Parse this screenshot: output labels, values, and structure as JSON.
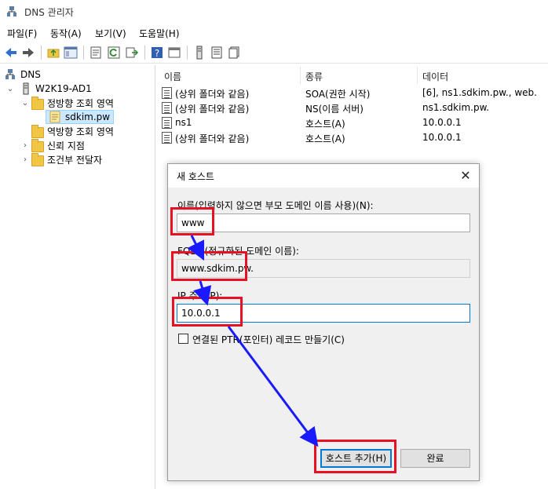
{
  "window": {
    "title": "DNS 관리자"
  },
  "menu": [
    "파일(F)",
    "동작(A)",
    "보기(V)",
    "도움말(H)"
  ],
  "toolbar": {
    "icons": [
      "back-icon",
      "forward-icon",
      "up-folder-icon",
      "show-tree-icon",
      "properties-icon",
      "refresh-icon",
      "export-icon",
      "help-icon",
      "console-icon",
      "server-icon",
      "record-icon",
      "copy-icon"
    ]
  },
  "tree": {
    "root": "DNS",
    "server": "W2K19-AD1",
    "forward_zone": "정방향 조회 영역",
    "zone": "sdkim.pw",
    "reverse_zone": "역방향 조회 영역",
    "trust_points": "신뢰 지점",
    "conditional_forwarders": "조건부 전달자"
  },
  "list": {
    "headers": [
      "이름",
      "종류",
      "데이터"
    ],
    "rows": [
      {
        "name": "(상위 폴더와 같음)",
        "type": "SOA(권한 시작)",
        "data": "[6], ns1.sdkim.pw., web."
      },
      {
        "name": "(상위 폴더와 같음)",
        "type": "NS(이름 서버)",
        "data": "ns1.sdkim.pw."
      },
      {
        "name": "ns1",
        "type": "호스트(A)",
        "data": "10.0.0.1"
      },
      {
        "name": "(상위 폴더와 같음)",
        "type": "호스트(A)",
        "data": "10.0.0.1"
      }
    ]
  },
  "dialog": {
    "title": "새 호스트",
    "close": "✕",
    "name_label": "이름(입력하지 않으면 부모 도메인 이름 사용)(N):",
    "name_value": "www",
    "fqdn_label": "FQDN(정규화된 도메인 이름):",
    "fqdn_value": "www.sdkim.pw.",
    "ip_label": "IP 주소(P):",
    "ip_value": "10.0.0.1",
    "ptr_label": "연결된 PTR(포인터) 레코드 만들기(C)",
    "add_button": "호스트 추가(H)",
    "done_button": "완료"
  },
  "colors": {
    "highlight": "#e81123",
    "arrow": "#1a1aff",
    "accent": "#0078d7"
  }
}
